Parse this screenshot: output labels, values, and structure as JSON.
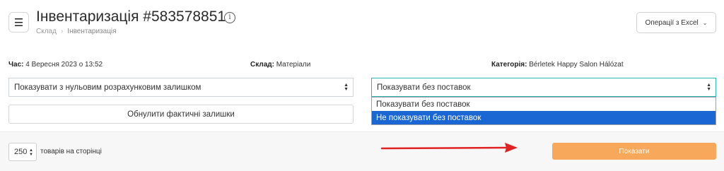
{
  "header": {
    "menu_icon": "hamburger-menu-icon",
    "title": "Інвентаризація #583578851",
    "info_icon": "info-icon",
    "info_glyph": "i",
    "breadcrumb": [
      "Склад",
      "Інвентаризація"
    ],
    "excel_button": "Операції з Excel"
  },
  "info": {
    "time_label": "Час:",
    "time_value": "4 Вересня 2023 о 13:52",
    "warehouse_label": "Склад:",
    "warehouse_value": "Матеріали",
    "category_label": "Категорія:",
    "category_value": "Bérletek Happy Salon Hálózat"
  },
  "filters": {
    "zero_balance_select": "Показувати з нульовим розрахунковим залишком",
    "supply_select": "Показувати без поставок",
    "supply_options": [
      "Показувати без поставок",
      "Не показувати без поставок"
    ],
    "supply_highlighted_option": "Не показувати без поставок",
    "reset_button": "Обнулити фактичні залишки"
  },
  "footer": {
    "per_page_value": "250",
    "per_page_label": "товарів на сторінці",
    "show_button": "Показати"
  },
  "colors": {
    "accent_orange": "#f7a85b",
    "highlight_blue": "#1a66d2",
    "focus_teal": "#2bb7ad",
    "annotation_arrow": "#e02222"
  }
}
